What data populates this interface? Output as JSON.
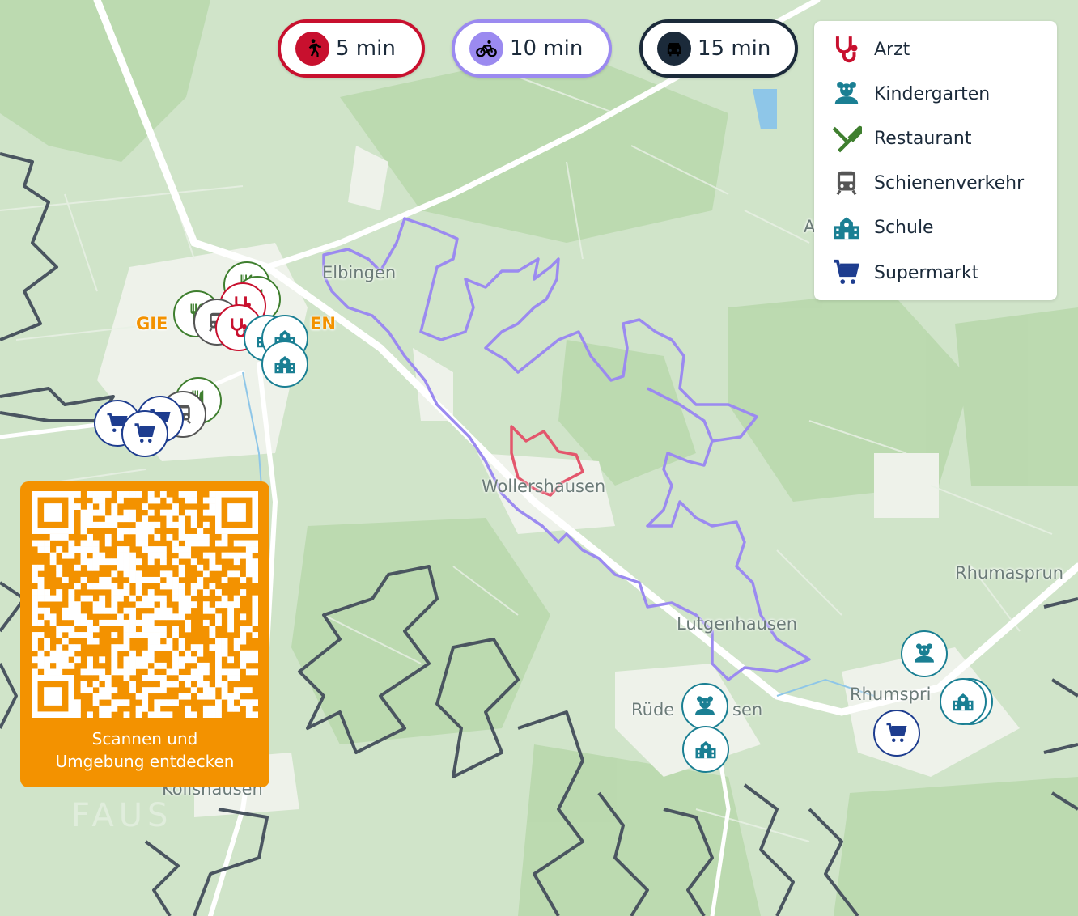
{
  "travel_filters": [
    {
      "label": "5 min",
      "mode_icon": "walking-icon",
      "color": "#c8102e"
    },
    {
      "label": "10 min",
      "mode_icon": "bicycle-icon",
      "color": "#9b8af0"
    },
    {
      "label": "15 min",
      "mode_icon": "car-icon",
      "color": "#1b2a3a"
    }
  ],
  "legend": [
    {
      "label": "Arzt",
      "icon": "stethoscope-icon",
      "color": "#c8102e"
    },
    {
      "label": "Kindergarten",
      "icon": "teddy-bear-icon",
      "color": "#1a7f93"
    },
    {
      "label": "Restaurant",
      "icon": "fork-knife-icon",
      "color": "#3f7f2f"
    },
    {
      "label": "Schienenverkehr",
      "icon": "train-icon",
      "color": "#555555"
    },
    {
      "label": "Schule",
      "icon": "school-icon",
      "color": "#1a7f93"
    },
    {
      "label": "Supermarkt",
      "icon": "shopping-cart-icon",
      "color": "#1e3d8f"
    }
  ],
  "places": {
    "elbingen": "Elbingen",
    "giebold_a": "GIE",
    "giebold_b": "EN",
    "wollershausen": "Wollershausen",
    "lutgenhausen": "Lutgenhausen",
    "rude_a": "Rüde",
    "rude_b": "sen",
    "rhumaspr": "Rhumasprun",
    "rhumspr": "Rhumspri",
    "kolls": "Kollshausen",
    "a_label": "A"
  },
  "qr": {
    "caption_line1": "Scannen und",
    "caption_line2": "Umgebung entdecken"
  },
  "watermark": "FAUS"
}
